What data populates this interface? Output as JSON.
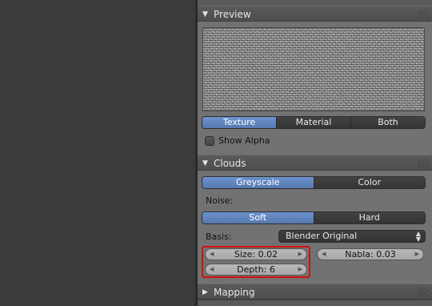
{
  "panels": {
    "preview": {
      "title": "Preview",
      "tabs": [
        "Texture",
        "Material",
        "Both"
      ],
      "active_tab": "Texture",
      "show_alpha_label": "Show Alpha",
      "show_alpha_checked": false
    },
    "clouds": {
      "title": "Clouds",
      "color_modes": [
        "Greyscale",
        "Color"
      ],
      "active_color_mode": "Greyscale",
      "noise_label": "Noise:",
      "noise_types": [
        "Soft",
        "Hard"
      ],
      "active_noise": "Soft",
      "basis_label": "Basis:",
      "basis_value": "Blender Original",
      "size_field": "Size: 0.02",
      "nabla_field": "Nabla: 0.03",
      "depth_field": "Depth: 6"
    },
    "mapping": {
      "title": "Mapping"
    }
  },
  "colors": {
    "active": "#5f84c2",
    "highlight": "#d21010"
  }
}
